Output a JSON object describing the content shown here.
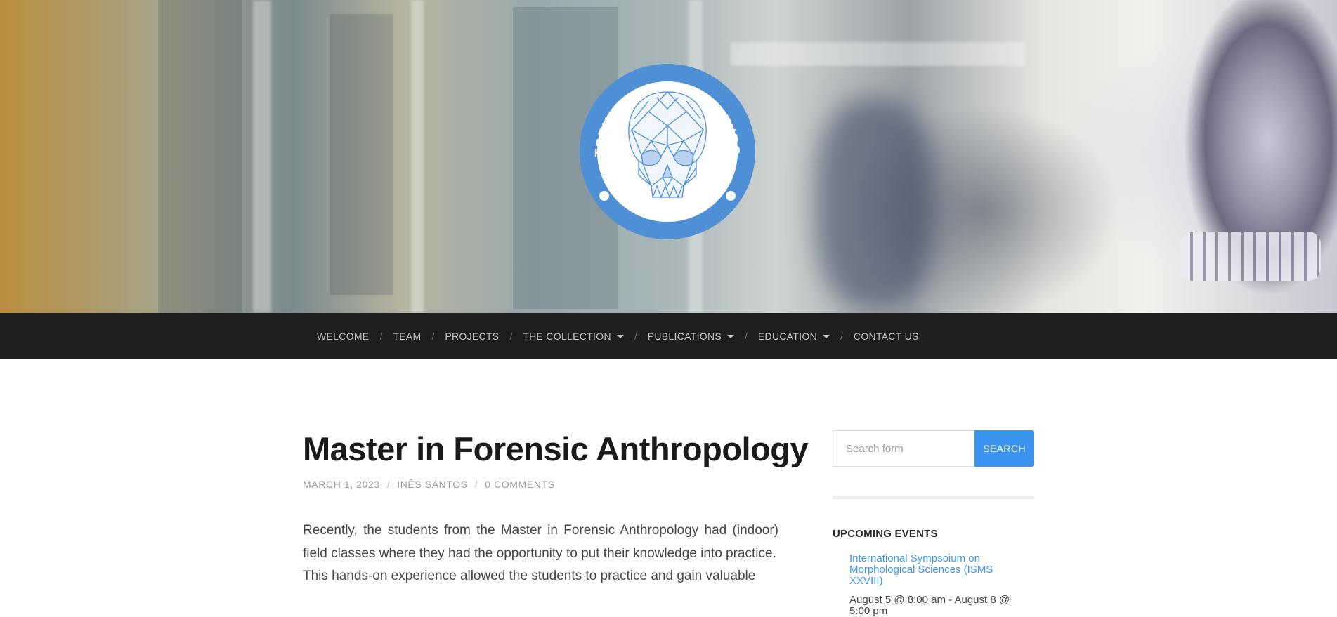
{
  "hero": {
    "logo_name": "Laboratory of Forensic Anthropology logo",
    "logo_top_text": "LABORATORY OF FORENSIC ANTHROPOLOGY",
    "logo_bottom_text": "UNIVERSITY OF COIMBRA"
  },
  "nav": {
    "items": [
      {
        "label": "WELCOME",
        "dropdown": false
      },
      {
        "label": "TEAM",
        "dropdown": false
      },
      {
        "label": "PROJECTS",
        "dropdown": false
      },
      {
        "label": "THE COLLECTION",
        "dropdown": true
      },
      {
        "label": "PUBLICATIONS",
        "dropdown": true
      },
      {
        "label": "EDUCATION",
        "dropdown": true
      },
      {
        "label": "CONTACT US",
        "dropdown": false
      }
    ],
    "separator": "/"
  },
  "post": {
    "title": "Master in Forensic Anthropology",
    "date": "MARCH 1, 2023",
    "author": "INÊS SANTOS",
    "comments": "0 COMMENTS",
    "paragraphs": [
      "Recently, the students from the Master in Forensic Anthropology had (indoor) field classes where they had the opportunity to put their knowledge into practice.",
      "This hands-on experience allowed the students to practice and gain valuable"
    ]
  },
  "sidebar": {
    "search_placeholder": "Search form",
    "search_button": "SEARCH",
    "events_title": "UPCOMING EVENTS",
    "events": [
      {
        "title": "International Sympsoium on Morphological Sciences (ISMS XXVIII)",
        "when": "August 5 @ 8:00 am - August 8 @ 5:00 pm"
      }
    ]
  },
  "colors": {
    "accent": "#3b95f0",
    "nav_bg": "#1e1e1e",
    "logo_blue": "#4f8fd6"
  }
}
